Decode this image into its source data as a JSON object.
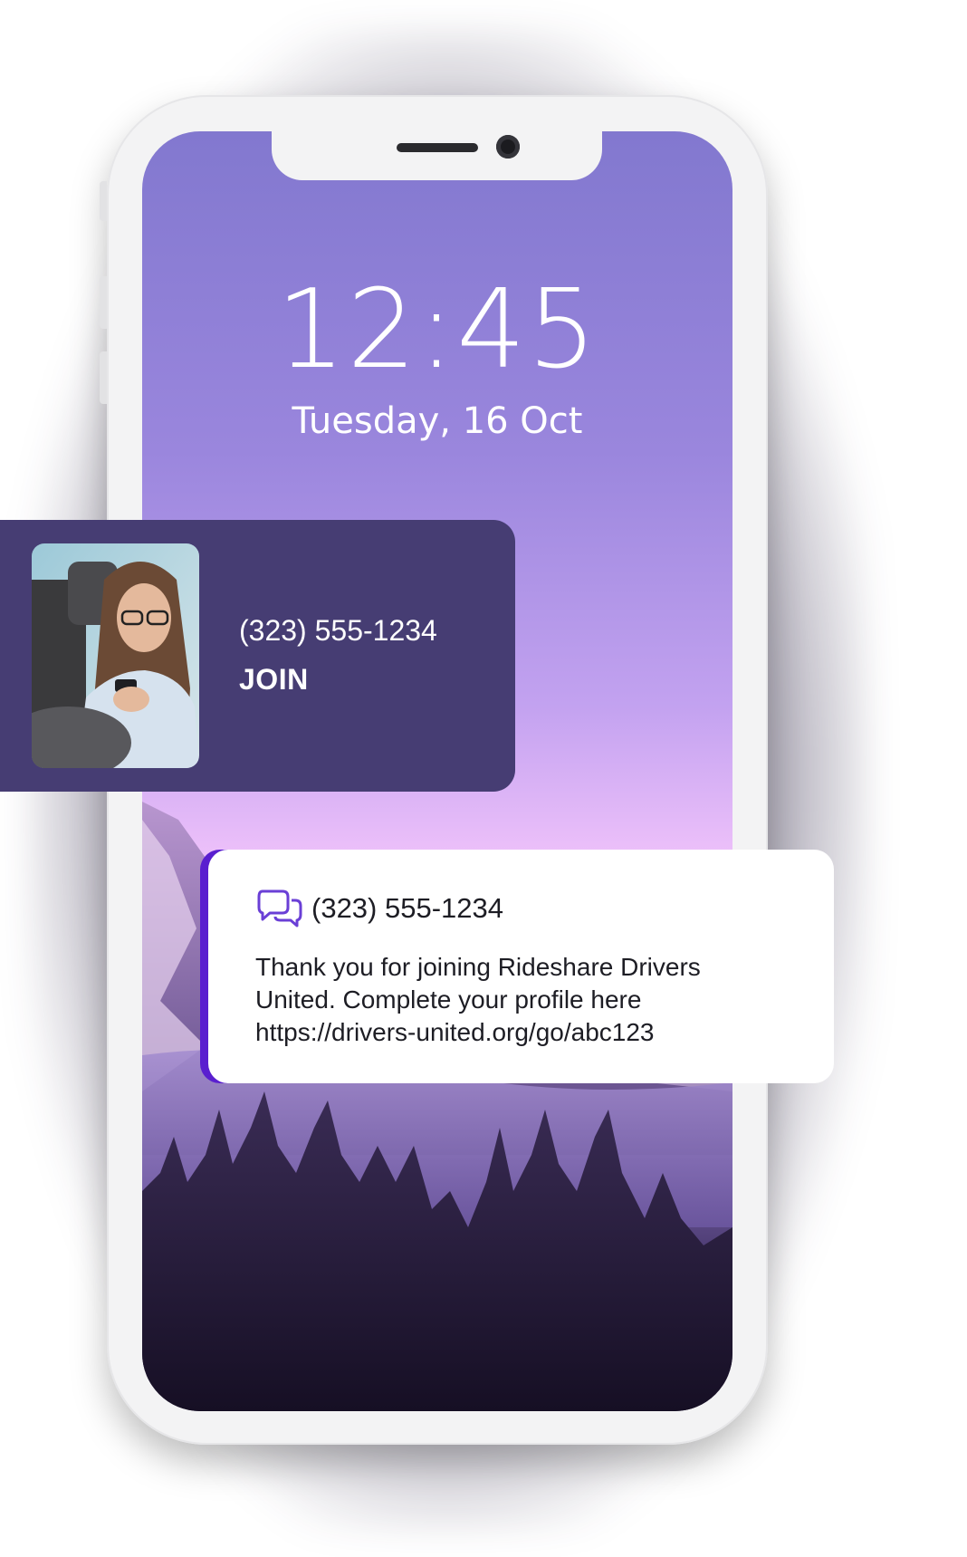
{
  "lock_screen": {
    "time": "12:45",
    "date": "Tuesday, 16 Oct"
  },
  "call_notification": {
    "number": "(323) 555-1234",
    "label": "JOIN",
    "photo_icon": "driver-photo"
  },
  "sms_notification": {
    "icon": "chat-bubbles-icon",
    "number": "(323) 555-1234",
    "message_lines": [
      "Thank you for joining Rideshare Drivers",
      "United. Complete your profile here",
      "https://drivers-united.org/go/abc123"
    ]
  },
  "colors": {
    "card_bg": "#463d73",
    "accent": "#5a1fcf",
    "icon": "#6a3fd6"
  }
}
